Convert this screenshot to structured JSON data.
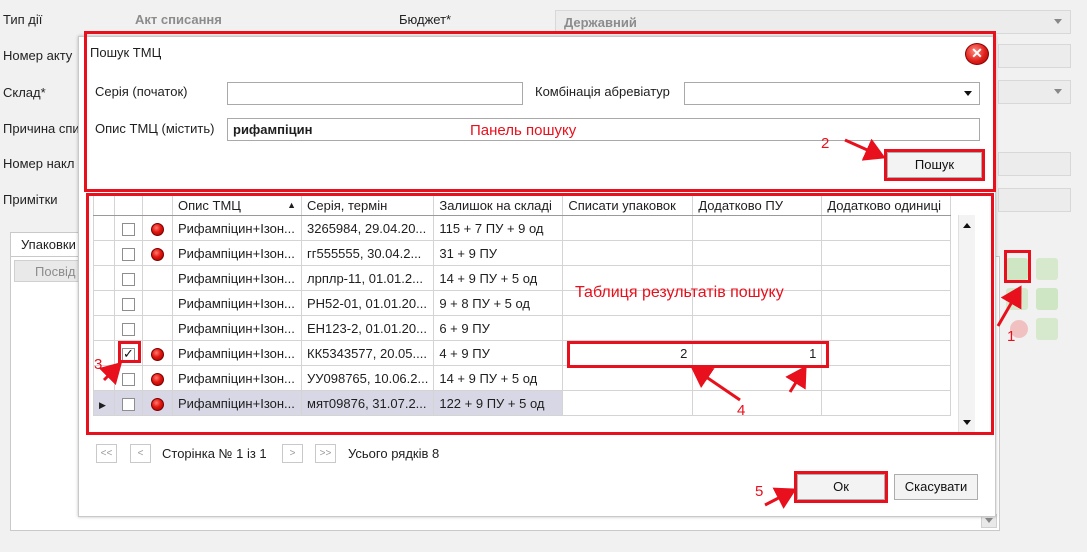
{
  "background_form": {
    "type_label": "Тип дії",
    "type_value": "Акт списання",
    "budget_label": "Бюджет*",
    "budget_value": "Державний",
    "act_number_label": "Номер акту",
    "warehouse_label": "Склад*",
    "reason_label": "Причина спи",
    "invoice_number_label": "Номер накл",
    "notes_label": "Примітки",
    "tab_label": "Упаковки",
    "column_label": "Посвід"
  },
  "dialog": {
    "title": "Пошук ТМЦ",
    "series_label": "Серія (початок)",
    "series_value": "",
    "combo_label": "Комбінація абревіатур",
    "combo_value": "",
    "desc_label": "Опис ТМЦ (містить)",
    "desc_value": "рифампіцин",
    "search_button": "Пошук",
    "ok_button": "Ок",
    "cancel_button": "Скасувати"
  },
  "grid": {
    "columns": [
      "Опис ТМЦ",
      "Серія, термін",
      "Залишок на складі",
      "Списати упаковок",
      "Додатково ПУ",
      "Додатково одиниці"
    ],
    "rows": [
      {
        "checked": false,
        "dot": true,
        "desc": "Рифампіцин+Ізон...",
        "series": "3265984, 29.04.20...",
        "stock": "115 + 7 ПУ + 9 од",
        "write_off": "",
        "extra_pu": "",
        "extra_units": ""
      },
      {
        "checked": false,
        "dot": true,
        "desc": "Рифампіцин+Ізон...",
        "series": "гг555555, 30.04.2...",
        "stock": "31 + 9 ПУ",
        "write_off": "",
        "extra_pu": "",
        "extra_units": ""
      },
      {
        "checked": false,
        "dot": false,
        "desc": "Рифампіцин+Ізон...",
        "series": "лрплр-11, 01.01.2...",
        "stock": "14 + 9 ПУ + 5 од",
        "write_off": "",
        "extra_pu": "",
        "extra_units": ""
      },
      {
        "checked": false,
        "dot": false,
        "desc": "Рифампіцин+Ізон...",
        "series": "РН52-01, 01.01.20...",
        "stock": "9 + 8 ПУ + 5 од",
        "write_off": "",
        "extra_pu": "",
        "extra_units": ""
      },
      {
        "checked": false,
        "dot": false,
        "desc": "Рифампіцин+Ізон...",
        "series": "ЕН123-2, 01.01.20...",
        "stock": "6 + 9 ПУ",
        "write_off": "",
        "extra_pu": "",
        "extra_units": ""
      },
      {
        "checked": true,
        "dot": true,
        "desc": "Рифампіцин+Ізон...",
        "series": "КК5343577, 20.05....",
        "stock": "4 + 9 ПУ",
        "write_off": "2",
        "extra_pu": "1",
        "extra_units": ""
      },
      {
        "checked": false,
        "dot": true,
        "desc": "Рифампіцин+Ізон...",
        "series": "УУ098765, 10.06.2...",
        "stock": "14 + 9 ПУ + 5 од",
        "write_off": "",
        "extra_pu": "",
        "extra_units": ""
      },
      {
        "checked": false,
        "dot": true,
        "desc": "Рифампіцин+Ізон...",
        "series": "мят09876, 31.07.2...",
        "stock": "122 + 9 ПУ + 5 од",
        "write_off": "",
        "extra_pu": "",
        "extra_units": ""
      }
    ]
  },
  "pager": {
    "first": "<<",
    "prev": "<",
    "page_text": "Сторінка № 1 із 1",
    "next": ">",
    "last": ">>",
    "total_text": "Усього рядків 8"
  },
  "annotations": {
    "search_panel": "Панель пошуку",
    "results_table": "Таблиця результатів пошуку",
    "n1": "1",
    "n2": "2",
    "n3": "3",
    "n4": "4",
    "n5": "5"
  },
  "colors": {
    "annotation_red": "#e8101c",
    "selected_row": "#d7d7e6"
  }
}
